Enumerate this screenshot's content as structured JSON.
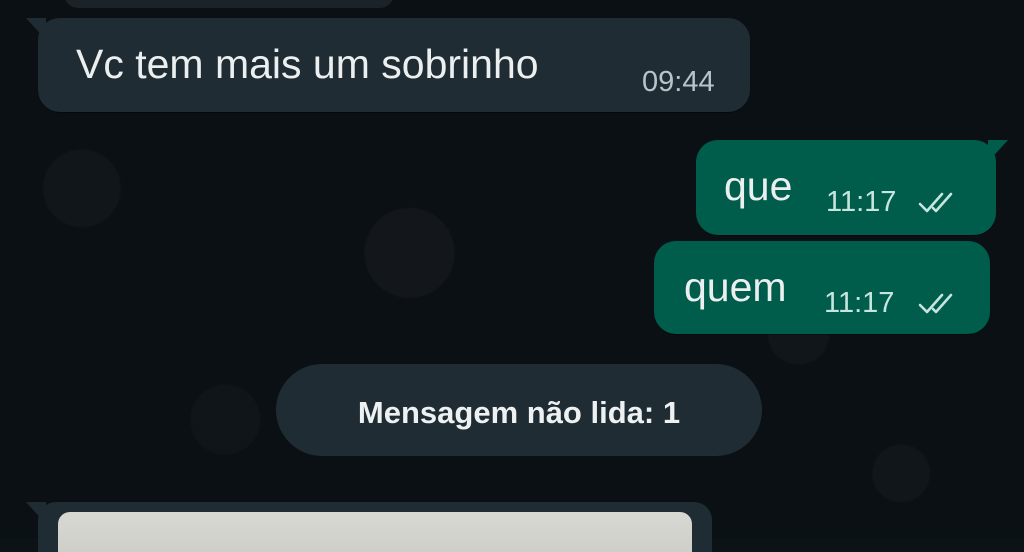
{
  "messages": [
    {
      "direction": "incoming",
      "text": "Vc tem mais um sobrinho",
      "time": "09:44"
    },
    {
      "direction": "outgoing",
      "text": "que",
      "time": "11:17",
      "status": "read"
    },
    {
      "direction": "outgoing",
      "text": "quem",
      "time": "11:17",
      "status": "read"
    }
  ],
  "unread_banner": {
    "label": "Mensagem não lida: 1"
  },
  "colors": {
    "background": "#0b1014",
    "incoming_bubble": "#1f2c33",
    "outgoing_bubble": "#005c4b",
    "read_ticks": "#c7e5df"
  }
}
